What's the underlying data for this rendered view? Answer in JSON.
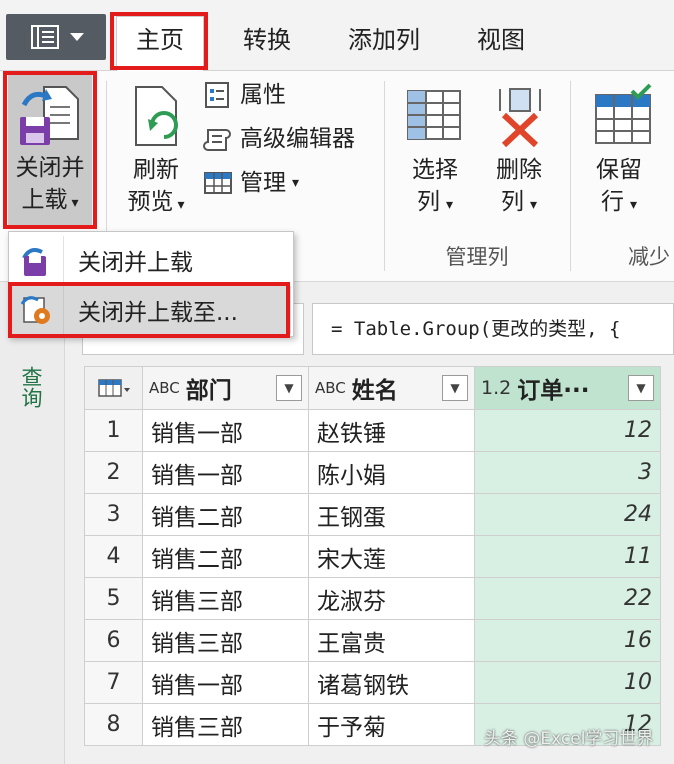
{
  "tabs": [
    {
      "label": "主页"
    },
    {
      "label": "转换"
    },
    {
      "label": "添加列"
    },
    {
      "label": "视图"
    }
  ],
  "ribbon": {
    "close_load": {
      "line1": "关闭并",
      "line2": "上载",
      "arrow": "▾"
    },
    "refresh": {
      "line1": "刷新",
      "line2": "预览",
      "arrow": "▾"
    },
    "properties": "属性",
    "advanced_editor": "高级编辑器",
    "manage": "管理",
    "manage_arrow": "▾",
    "choose_columns": {
      "line1": "选择",
      "line2": "列",
      "arrow": "▾"
    },
    "remove_columns": {
      "line1": "删除",
      "line2": "列",
      "arrow": "▾"
    },
    "keep_rows": {
      "line1": "保留",
      "line2": "行",
      "arrow": "▾"
    },
    "group_manage_columns": "管理列",
    "group_reduce_rows": "减少"
  },
  "dropdown": {
    "items": [
      {
        "label": "关闭并上载"
      },
      {
        "label": "关闭并上载至..."
      }
    ]
  },
  "left_nav": {
    "label": "查询"
  },
  "formula_bar": {
    "text": "= Table.Group(更改的类型, {"
  },
  "grid": {
    "columns": [
      {
        "type": "ABC",
        "name": "部门"
      },
      {
        "type": "ABC",
        "name": "姓名"
      },
      {
        "type": "1.2",
        "name": "订单···"
      }
    ],
    "rows": [
      {
        "n": "1",
        "dept": "销售一部",
        "name": "赵铁锤",
        "orders": "12"
      },
      {
        "n": "2",
        "dept": "销售一部",
        "name": "陈小娟",
        "orders": "3"
      },
      {
        "n": "3",
        "dept": "销售二部",
        "name": "王钢蛋",
        "orders": "24"
      },
      {
        "n": "4",
        "dept": "销售二部",
        "name": "宋大莲",
        "orders": "11"
      },
      {
        "n": "5",
        "dept": "销售三部",
        "name": "龙淑芬",
        "orders": "22"
      },
      {
        "n": "6",
        "dept": "销售三部",
        "name": "王富贵",
        "orders": "16"
      },
      {
        "n": "7",
        "dept": "销售一部",
        "name": "诸葛钢铁",
        "orders": "10"
      },
      {
        "n": "8",
        "dept": "销售三部",
        "name": "于予菊",
        "orders": "12"
      }
    ]
  },
  "watermark": "头条 @Excel学习世界",
  "colors": {
    "highlight_red": "#e31b1b",
    "numeric_column": "#d8efe3",
    "accent_green": "#217346"
  }
}
